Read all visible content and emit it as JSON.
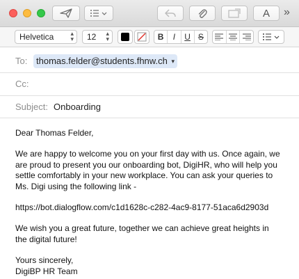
{
  "format_bar": {
    "font_family": "Helvetica",
    "font_size": "12",
    "bold_label": "B",
    "italic_label": "I",
    "underline_label": "U",
    "strike_label": "S"
  },
  "toolbar": {
    "font_button_label": "A",
    "overflow_label": "»"
  },
  "header": {
    "to_label": "To:",
    "to_value": "thomas.felder@students.fhnw.ch",
    "cc_label": "Cc:",
    "subject_label": "Subject:",
    "subject_value": "Onboarding"
  },
  "body": {
    "greeting": "Dear Thomas Felder,",
    "para1_line1": "We are happy to welcome you on your first day with us. Once again, we",
    "para1_line2": "are proud to present you our onboarding bot, DigiHR, who will help you",
    "para1_line3": "settle comfortably in your new workplace. You can ask your queries to",
    "para1_line4": "Ms. Digi using the following link -",
    "link": "https://bot.dialogflow.com/c1d1628c-c282-4ac9-8177-51aca6d2903d",
    "para2_line1": "We wish you a great future, together we can achieve great heights in",
    "para2_line2": "the digital future!",
    "closing": "Yours sincerely,",
    "signature": "DigiBP HR Team"
  }
}
